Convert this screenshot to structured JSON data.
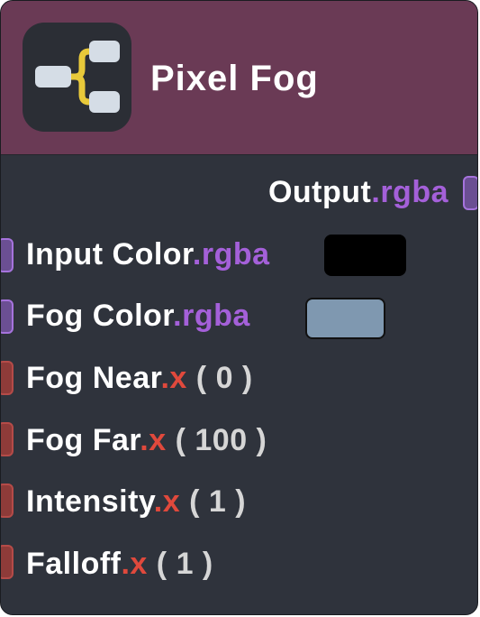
{
  "node": {
    "title": "Pixel Fog",
    "icon": "branch-icon",
    "header_color": "#6a3a55",
    "body_color": "#2f333c"
  },
  "output": {
    "label": "Output",
    "suffix": ".rgba"
  },
  "inputs": [
    {
      "label": "Input Color",
      "suffix": ".rgba",
      "type": "rgba",
      "swatch_color": "#000000"
    },
    {
      "label": "Fog Color",
      "suffix": ".rgba",
      "type": "rgba",
      "swatch_color": "#7f98b0"
    },
    {
      "label": "Fog Near",
      "suffix": ".x",
      "type": "x",
      "default": "( 0 )"
    },
    {
      "label": "Fog Far",
      "suffix": ".x",
      "type": "x",
      "default": "( 100 )"
    },
    {
      "label": "Intensity",
      "suffix": ".x",
      "type": "x",
      "default": "( 1 )"
    },
    {
      "label": "Falloff",
      "suffix": ".x",
      "type": "x",
      "default": "( 1 )"
    }
  ],
  "colors": {
    "rgba_accent": "#a460d9",
    "x_accent": "#e0493c"
  }
}
